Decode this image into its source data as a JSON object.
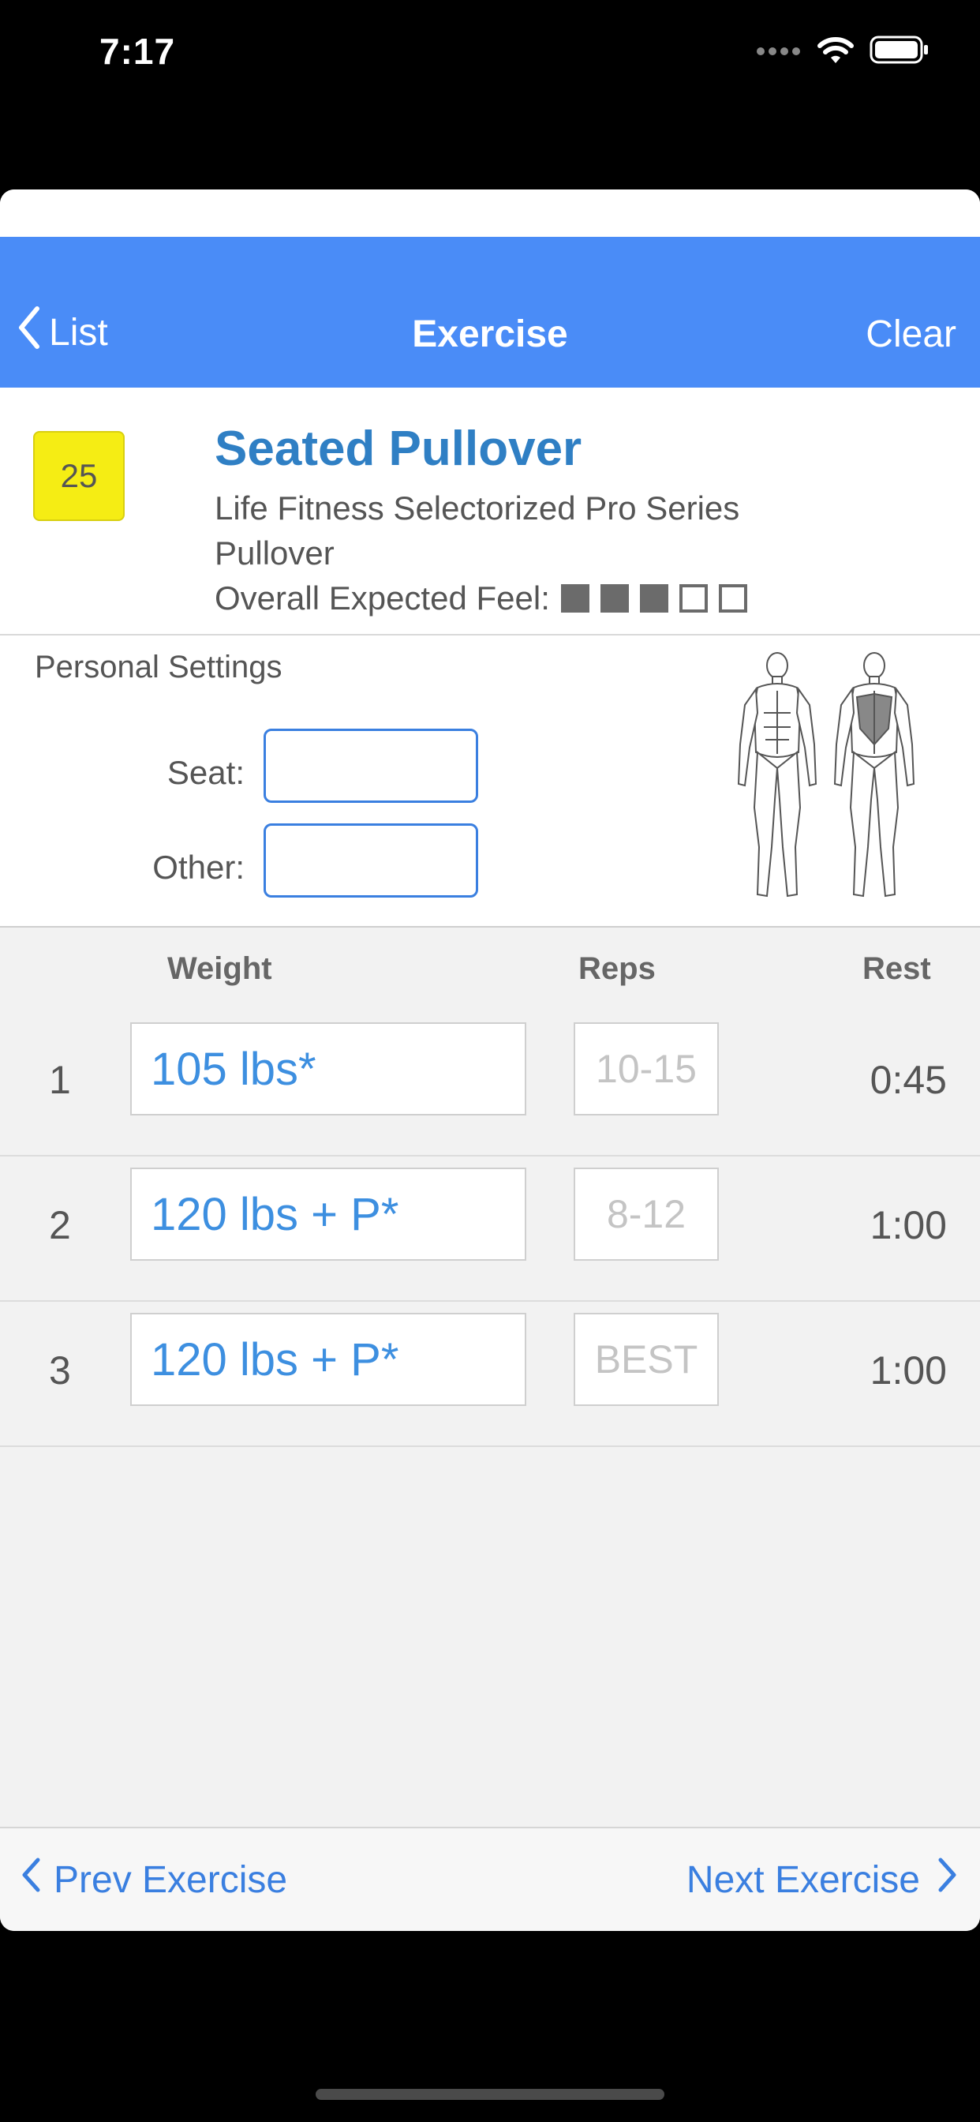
{
  "status_bar": {
    "time": "7:17",
    "icons": [
      "signal-dots-icon",
      "wifi-icon",
      "battery-icon"
    ]
  },
  "navbar": {
    "back_label": "List",
    "title": "Exercise",
    "clear_label": "Clear",
    "color": "#4a8cf7"
  },
  "exercise": {
    "badge_number": "25",
    "badge_color": "#f5ed14",
    "title": "Seated Pullover",
    "subtitle_line1": "Life Fitness Selectorized Pro Series",
    "subtitle_line2": "Pullover",
    "feel_label": "Overall Expected Feel:",
    "feel_level": 3,
    "feel_max": 5
  },
  "personal_settings": {
    "title": "Personal Settings",
    "seat_label": "Seat:",
    "seat_value": "",
    "other_label": "Other:",
    "other_value": ""
  },
  "table": {
    "headers": {
      "weight": "Weight",
      "reps": "Reps",
      "rest": "Rest"
    },
    "rows": [
      {
        "set": "1",
        "weight": "105 lbs*",
        "reps": "10-15",
        "rest": "0:45"
      },
      {
        "set": "2",
        "weight": "120 lbs + P*",
        "reps": "8-12",
        "rest": "1:00"
      },
      {
        "set": "3",
        "weight": "120 lbs + P*",
        "reps": "BEST",
        "rest": "1:00"
      }
    ]
  },
  "bottom_nav": {
    "prev_label": "Prev Exercise",
    "next_label": "Next Exercise"
  }
}
